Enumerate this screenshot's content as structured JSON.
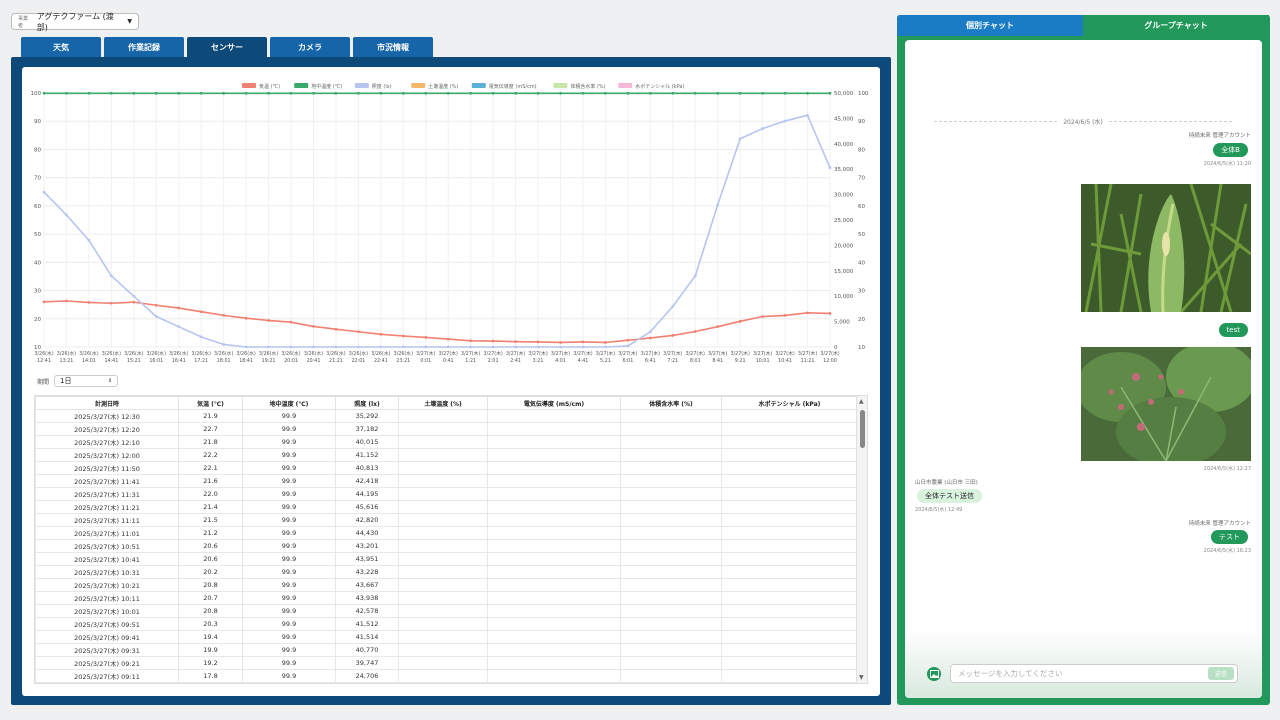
{
  "farm": {
    "label": "事業者",
    "name": "アグテクファーム (渡部)"
  },
  "tabs": [
    {
      "label": "天気"
    },
    {
      "label": "作業記録"
    },
    {
      "label": "センサー"
    },
    {
      "label": "カメラ"
    },
    {
      "label": "市況情報"
    }
  ],
  "legend": [
    "気温 (℃)",
    "地中温度 (℃)",
    "照度 (lx)",
    "土壌温度 (%)",
    "電気伝導度 (mS/cm)",
    "体積含水率 (%)",
    "水ポテンシャル (kPa)"
  ],
  "legend_colors": [
    "#f08070",
    "#3aa86b",
    "#b8c4f0",
    "#f5b86a",
    "#5aaed8",
    "#c9e4a8",
    "#f7b8d8"
  ],
  "chart_data": {
    "type": "line",
    "x": [
      "3/26(水) 12:41",
      "3/26(水) 13:21",
      "3/26(水) 14:01",
      "3/26(水) 14:41",
      "3/26(水) 15:21",
      "3/26(水) 16:01",
      "3/26(水) 16:41",
      "3/26(水) 17:21",
      "3/26(水) 18:01",
      "3/26(水) 18:41",
      "3/26(水) 19:21",
      "3/26(水) 20:01",
      "3/26(水) 20:41",
      "3/26(水) 21:21",
      "3/26(水) 22:01",
      "3/26(水) 22:41",
      "3/26(水) 23:21",
      "3/27(木) 0:01",
      "3/27(木) 0:41",
      "3/27(木) 1:21",
      "3/27(木) 2:01",
      "3/27(木) 2:41",
      "3/27(木) 3:21",
      "3/27(木) 4:01",
      "3/27(木) 4:41",
      "3/27(木) 5:21",
      "3/27(木) 6:01",
      "3/27(木) 6:41",
      "3/27(木) 7:21",
      "3/27(木) 8:01",
      "3/27(木) 8:41",
      "3/27(木) 9:21",
      "3/27(木) 10:01",
      "3/27(木) 10:41",
      "3/27(木) 11:21",
      "3/27(木) 12:00"
    ],
    "series": [
      {
        "name": "気温 (℃)",
        "color": "#f08070",
        "axis": "left",
        "values": [
          26,
          26.3,
          25.8,
          25.5,
          25.9,
          24.8,
          23.8,
          22.5,
          21.2,
          20.2,
          19.4,
          18.8,
          17.3,
          16.3,
          15.4,
          14.5,
          13.9,
          13.4,
          12.8,
          12.2,
          12.1,
          11.9,
          11.8,
          11.6,
          11.8,
          11.6,
          12.4,
          13.2,
          14.1,
          15.5,
          17.2,
          19.1,
          20.8,
          21.2,
          22.1,
          21.9
        ]
      },
      {
        "name": "地中温度 (℃)",
        "color": "#3aa86b",
        "axis": "left",
        "values": [
          99.9,
          99.9,
          99.9,
          99.9,
          99.9,
          99.9,
          99.9,
          99.9,
          99.9,
          99.9,
          99.9,
          99.9,
          99.9,
          99.9,
          99.9,
          99.9,
          99.9,
          99.9,
          99.9,
          99.9,
          99.9,
          99.9,
          99.9,
          99.9,
          99.9,
          99.9,
          99.9,
          99.9,
          99.9,
          99.9,
          99.9,
          99.9,
          99.9,
          99.9,
          99.9,
          99.9
        ]
      },
      {
        "name": "照度 (lx)",
        "color": "#b8c4f0",
        "axis": "right",
        "values": [
          30500,
          26000,
          21000,
          14000,
          10000,
          6000,
          4000,
          2000,
          500,
          0,
          0,
          0,
          0,
          0,
          0,
          0,
          0,
          0,
          0,
          0,
          0,
          0,
          0,
          0,
          0,
          0,
          200,
          3000,
          8000,
          14000,
          28000,
          41000,
          43000,
          44500,
          45600,
          35292
        ]
      }
    ],
    "y_left": {
      "min": 10,
      "max": 100,
      "ticks": [
        10,
        20,
        30,
        40,
        50,
        60,
        70,
        80,
        90,
        100
      ]
    },
    "y_right": {
      "min": 0,
      "max": 50000,
      "ticks": [
        "0",
        "5,000",
        "10,000",
        "15,000",
        "20,000",
        "25,000",
        "30,000",
        "35,000",
        "40,000",
        "45,000",
        "50,000"
      ]
    },
    "y_right2": {
      "ticks": [
        10,
        20,
        30,
        40,
        50,
        60,
        70,
        80,
        90,
        100
      ]
    },
    "grid": true,
    "legend": "top-center"
  },
  "period": {
    "label": "期間",
    "value": "1日"
  },
  "table": {
    "headers": [
      "計測日時",
      "気温 (℃)",
      "地中温度 (℃)",
      "照度 (lx)",
      "土壌温度 (%)",
      "電気伝導度 (mS/cm)",
      "体積含水率 (%)",
      "水ポテンシャル (kPa)"
    ],
    "rows": [
      [
        "2025/3/27(木) 12:30",
        "21.9",
        "99.9",
        "35,292"
      ],
      [
        "2025/3/27(木) 12:20",
        "22.7",
        "99.9",
        "37,182"
      ],
      [
        "2025/3/27(木) 12:10",
        "21.8",
        "99.9",
        "40,015"
      ],
      [
        "2025/3/27(木) 12:00",
        "22.2",
        "99.9",
        "41,152"
      ],
      [
        "2025/3/27(木) 11:50",
        "22.1",
        "99.9",
        "40,813"
      ],
      [
        "2025/3/27(木) 11:41",
        "21.6",
        "99.9",
        "42,418"
      ],
      [
        "2025/3/27(木) 11:31",
        "22.0",
        "99.9",
        "44,195"
      ],
      [
        "2025/3/27(木) 11:21",
        "21.4",
        "99.9",
        "45,616"
      ],
      [
        "2025/3/27(木) 11:11",
        "21.5",
        "99.9",
        "42,820"
      ],
      [
        "2025/3/27(木) 11:01",
        "21.2",
        "99.9",
        "44,430"
      ],
      [
        "2025/3/27(木) 10:51",
        "20.6",
        "99.9",
        "43,201"
      ],
      [
        "2025/3/27(木) 10:41",
        "20.6",
        "99.9",
        "43,951"
      ],
      [
        "2025/3/27(木) 10:31",
        "20.2",
        "99.9",
        "43,228"
      ],
      [
        "2025/3/27(木) 10:21",
        "20.8",
        "99.9",
        "43,667"
      ],
      [
        "2025/3/27(木) 10:11",
        "20.7",
        "99.9",
        "43,938"
      ],
      [
        "2025/3/27(木) 10:01",
        "20.8",
        "99.9",
        "42,578"
      ],
      [
        "2025/3/27(木) 09:51",
        "20.3",
        "99.9",
        "41,512"
      ],
      [
        "2025/3/27(木) 09:41",
        "19.4",
        "99.9",
        "41,514"
      ],
      [
        "2025/3/27(木) 09:31",
        "19.9",
        "99.9",
        "40,770"
      ],
      [
        "2025/3/27(木) 09:21",
        "19.2",
        "99.9",
        "39,747"
      ],
      [
        "2025/3/27(木) 09:11",
        "17.8",
        "99.9",
        "24,706"
      ]
    ]
  },
  "chat": {
    "tab_individual": "個別チャット",
    "tab_group": "グループチャット",
    "date": "2024/6/5 (水)",
    "messages": [
      {
        "sender": "持続未来 管理アカウント",
        "text": "全体B",
        "time": "2024/6/5(水) 11:20"
      },
      {
        "text": "test",
        "time": "2024/6/5(水) 12:27"
      },
      {
        "sender": "山日市農業 (山日市 三田)",
        "text": "全体テスト送信",
        "time": "2024/6/5(水) 12:49"
      },
      {
        "sender": "持続未来 管理アカウント",
        "text": "テスト",
        "time": "2024/6/5(水) 16:23"
      }
    ],
    "input_placeholder": "メッセージを入力してください",
    "send_label": "送信"
  }
}
